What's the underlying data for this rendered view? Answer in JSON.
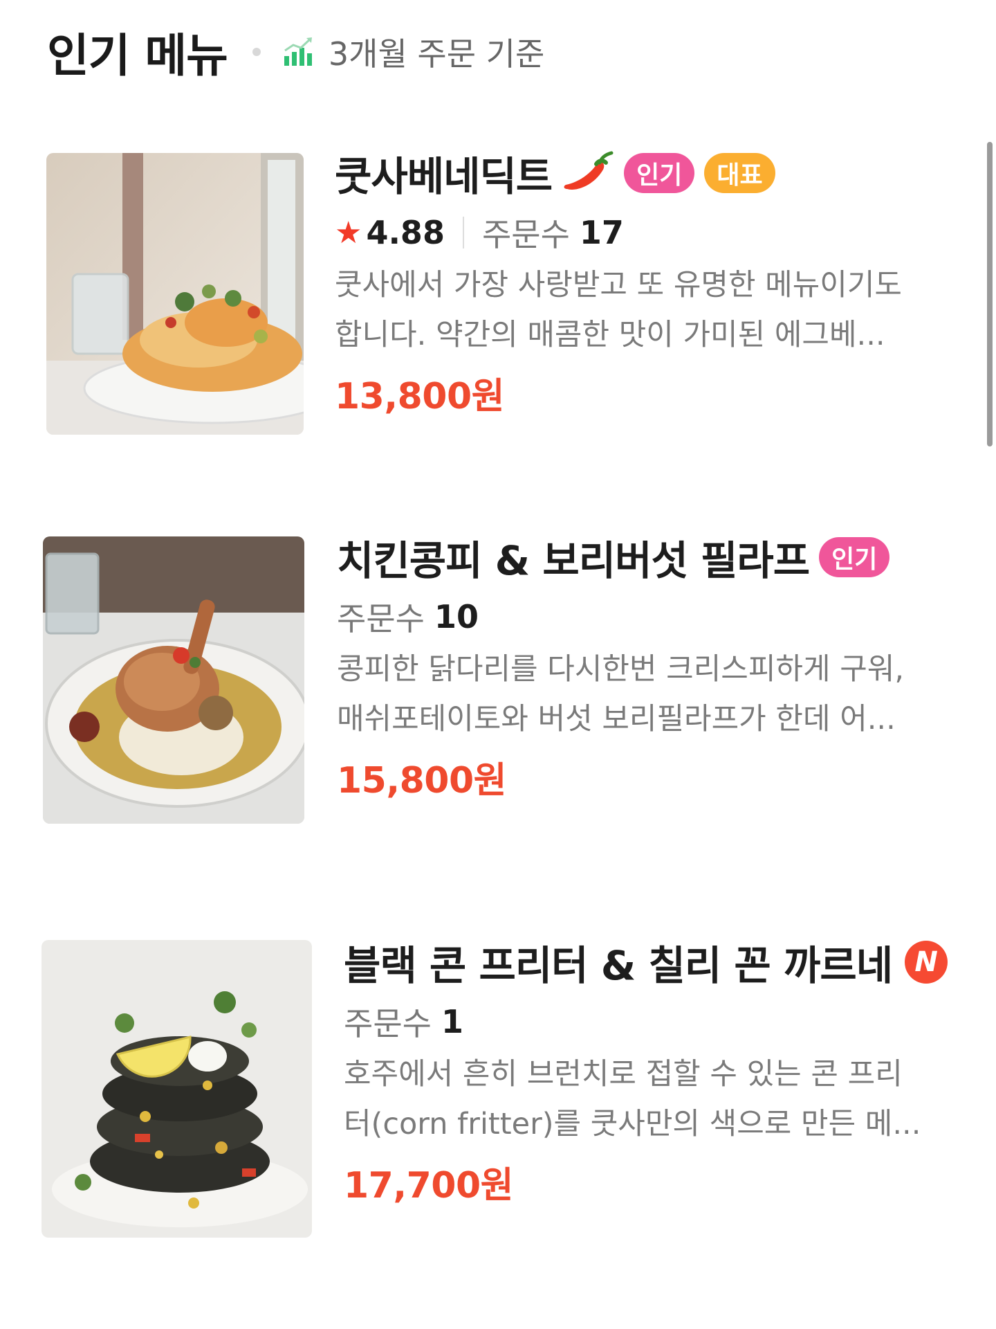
{
  "header": {
    "title": "인기 메뉴",
    "subtitle": "3개월 주문 기준",
    "chart_icon": "bar-chart-icon"
  },
  "items": [
    {
      "name": "쿳사베네딕트",
      "spicy_icon": "chili-pepper-icon",
      "badges": [
        "인기",
        "대표"
      ],
      "rating": "4.88",
      "orders_label": "주문수",
      "orders_count": "17",
      "desc_line1": "쿳사에서 가장 사랑받고 또 유명한 메뉴이기도",
      "desc_line2": "합니다. 약간의 매콤한 맛이 가미된 에그베...",
      "price": "13,800원",
      "image": "eggs-benedict-photo"
    },
    {
      "name": "치킨콩피 & 보리버섯 필라프",
      "badges": [
        "인기"
      ],
      "orders_label": "주문수",
      "orders_count": "10",
      "desc_line1": "콩피한 닭다리를 다시한번 크리스피하게 구워,",
      "desc_line2": "매쉬포테이토와 버섯 보리필라프가 한데 어...",
      "price": "15,800원",
      "image": "chicken-confit-photo"
    },
    {
      "name": "블랙 콘 프리터 & 칠리 꼰 까르네",
      "new_badge": "N",
      "orders_label": "주문수",
      "orders_count": "1",
      "desc_line1": "호주에서 흔히 브런치로 접할 수 있는 콘 프리",
      "desc_line2": "터(corn fritter)를 쿳사만의 색으로 만든 메...",
      "price": "17,700원",
      "image": "corn-fritter-photo"
    }
  ],
  "colors": {
    "price": "#ef4a2e",
    "badge_popular": "#f0569a",
    "badge_signature": "#fbae30",
    "new_badge": "#f64a32",
    "star": "#f23a28"
  }
}
